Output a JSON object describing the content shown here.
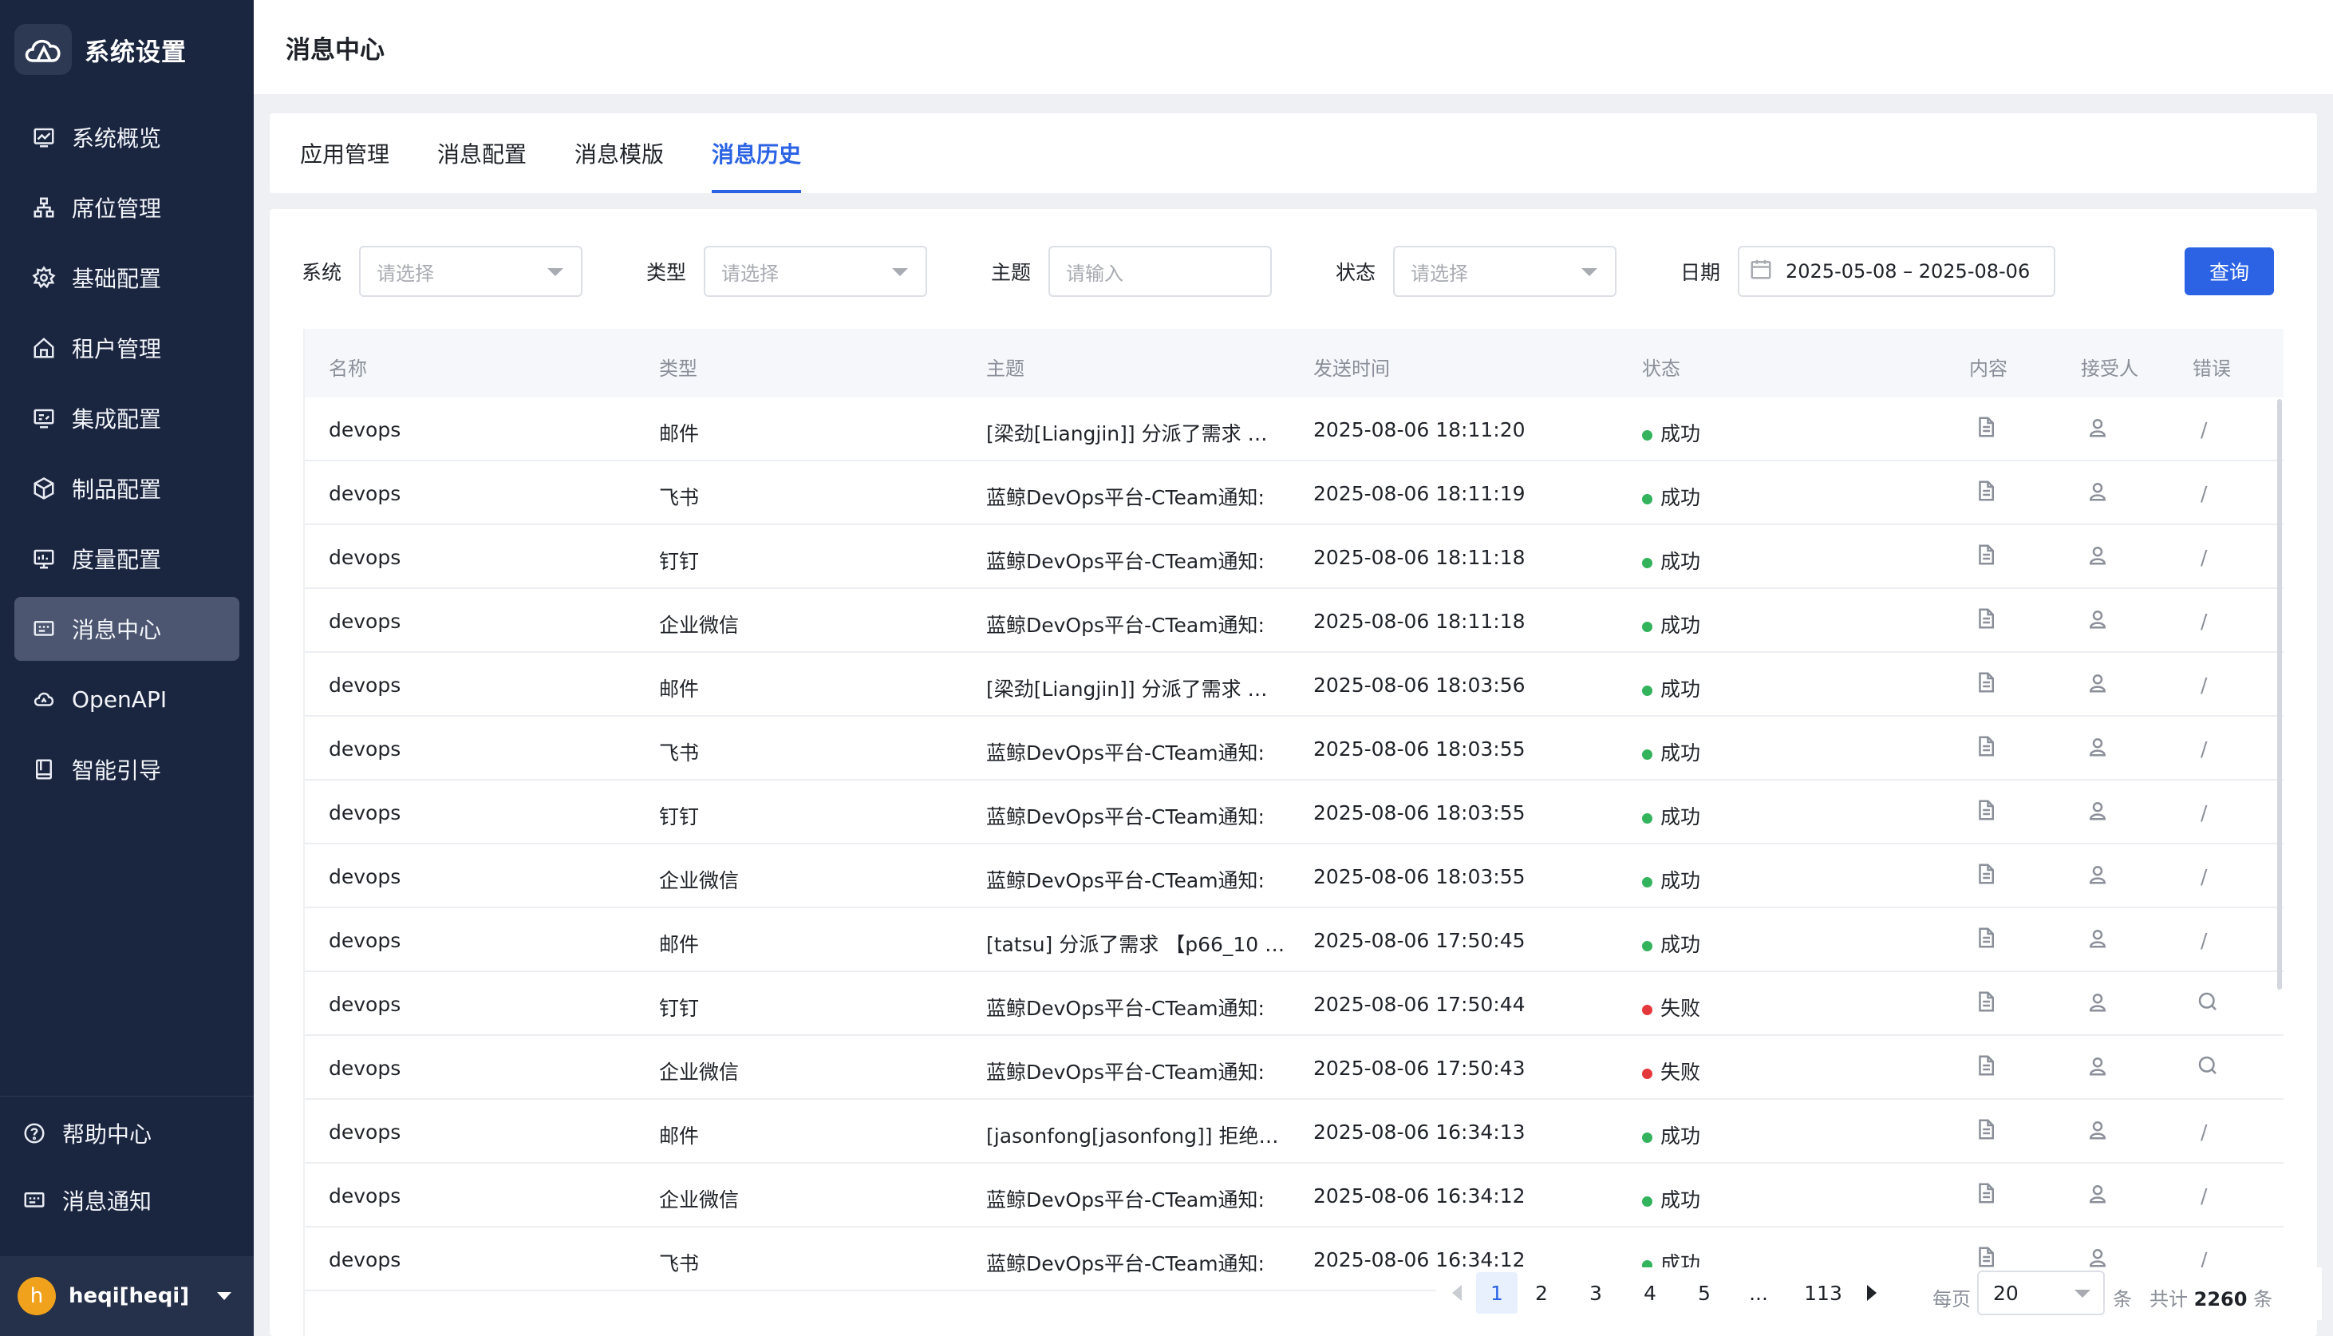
{
  "sidebar": {
    "title": "系统设置",
    "items": [
      {
        "label": "系统概览",
        "icon": "monitor-chart-icon"
      },
      {
        "label": "席位管理",
        "icon": "org-tree-icon"
      },
      {
        "label": "基础配置",
        "icon": "gear-icon"
      },
      {
        "label": "租户管理",
        "icon": "home-icon"
      },
      {
        "label": "集成配置",
        "icon": "integration-icon"
      },
      {
        "label": "制品配置",
        "icon": "package-icon"
      },
      {
        "label": "度量配置",
        "icon": "dashboard-icon"
      },
      {
        "label": "消息中心",
        "icon": "message-icon",
        "active": true
      },
      {
        "label": "OpenAPI",
        "icon": "cloud-api-icon"
      },
      {
        "label": "智能引导",
        "icon": "book-icon"
      }
    ],
    "bottom": [
      {
        "label": "帮助中心",
        "icon": "help-icon"
      },
      {
        "label": "消息通知",
        "icon": "notification-icon"
      }
    ],
    "user": {
      "avatar_letter": "h",
      "name": "heqi[heqi]"
    }
  },
  "header": {
    "title": "消息中心"
  },
  "tabs": [
    {
      "label": "应用管理"
    },
    {
      "label": "消息配置"
    },
    {
      "label": "消息模版"
    },
    {
      "label": "消息历史",
      "active": true
    }
  ],
  "filters": {
    "system": {
      "label": "系统",
      "placeholder": "请选择"
    },
    "type": {
      "label": "类型",
      "placeholder": "请选择"
    },
    "topic": {
      "label": "主题",
      "placeholder": "请输入"
    },
    "status": {
      "label": "状态",
      "placeholder": "请选择"
    },
    "date": {
      "label": "日期",
      "value": "2025-05-08 – 2025-08-06"
    },
    "query_button": "查询"
  },
  "table": {
    "columns": [
      "名称",
      "类型",
      "主题",
      "发送时间",
      "状态",
      "内容",
      "接受人",
      "错误"
    ],
    "rows": [
      {
        "name": "devops",
        "type": "邮件",
        "topic": "[梁劲[Liangjin]] 分派了需求 …",
        "time": "2025-08-06 18:11:20",
        "status": "成功",
        "ok": true,
        "error": "/"
      },
      {
        "name": "devops",
        "type": "飞书",
        "topic": "蓝鲸DevOps平台-CTeam通知:",
        "time": "2025-08-06 18:11:19",
        "status": "成功",
        "ok": true,
        "error": "/"
      },
      {
        "name": "devops",
        "type": "钉钉",
        "topic": "蓝鲸DevOps平台-CTeam通知:",
        "time": "2025-08-06 18:11:18",
        "status": "成功",
        "ok": true,
        "error": "/"
      },
      {
        "name": "devops",
        "type": "企业微信",
        "topic": "蓝鲸DevOps平台-CTeam通知:",
        "time": "2025-08-06 18:11:18",
        "status": "成功",
        "ok": true,
        "error": "/"
      },
      {
        "name": "devops",
        "type": "邮件",
        "topic": "[梁劲[Liangjin]] 分派了需求 …",
        "time": "2025-08-06 18:03:56",
        "status": "成功",
        "ok": true,
        "error": "/"
      },
      {
        "name": "devops",
        "type": "飞书",
        "topic": "蓝鲸DevOps平台-CTeam通知:",
        "time": "2025-08-06 18:03:55",
        "status": "成功",
        "ok": true,
        "error": "/"
      },
      {
        "name": "devops",
        "type": "钉钉",
        "topic": "蓝鲸DevOps平台-CTeam通知:",
        "time": "2025-08-06 18:03:55",
        "status": "成功",
        "ok": true,
        "error": "/"
      },
      {
        "name": "devops",
        "type": "企业微信",
        "topic": "蓝鲸DevOps平台-CTeam通知:",
        "time": "2025-08-06 18:03:55",
        "status": "成功",
        "ok": true,
        "error": "/"
      },
      {
        "name": "devops",
        "type": "邮件",
        "topic": "[tatsu] 分派了需求 【p66_10 …",
        "time": "2025-08-06 17:50:45",
        "status": "成功",
        "ok": true,
        "error": "/"
      },
      {
        "name": "devops",
        "type": "钉钉",
        "topic": "蓝鲸DevOps平台-CTeam通知:",
        "time": "2025-08-06 17:50:44",
        "status": "失败",
        "ok": false,
        "error": ""
      },
      {
        "name": "devops",
        "type": "企业微信",
        "topic": "蓝鲸DevOps平台-CTeam通知:",
        "time": "2025-08-06 17:50:43",
        "status": "失败",
        "ok": false,
        "error": ""
      },
      {
        "name": "devops",
        "type": "邮件",
        "topic": "[jasonfong[jasonfong]] 拒绝…",
        "time": "2025-08-06 16:34:13",
        "status": "成功",
        "ok": true,
        "error": "/"
      },
      {
        "name": "devops",
        "type": "企业微信",
        "topic": "蓝鲸DevOps平台-CTeam通知:",
        "time": "2025-08-06 16:34:12",
        "status": "成功",
        "ok": true,
        "error": "/"
      },
      {
        "name": "devops",
        "type": "飞书",
        "topic": "蓝鲸DevOps平台-CTeam通知:",
        "time": "2025-08-06 16:34:12",
        "status": "成功",
        "ok": true,
        "error": "/"
      }
    ]
  },
  "pagination": {
    "pages": [
      "1",
      "2",
      "3",
      "4",
      "5",
      "...",
      "113"
    ],
    "current": "1",
    "per_page_label": "每页",
    "per_page_value": "20",
    "per_page_unit": "条",
    "total_prefix": "共计",
    "total": "2260",
    "total_suffix": "条"
  },
  "colors": {
    "primary": "#2b63e4",
    "sidebar_bg": "#1a2540",
    "success": "#33b35b",
    "fail": "#e5383b"
  }
}
